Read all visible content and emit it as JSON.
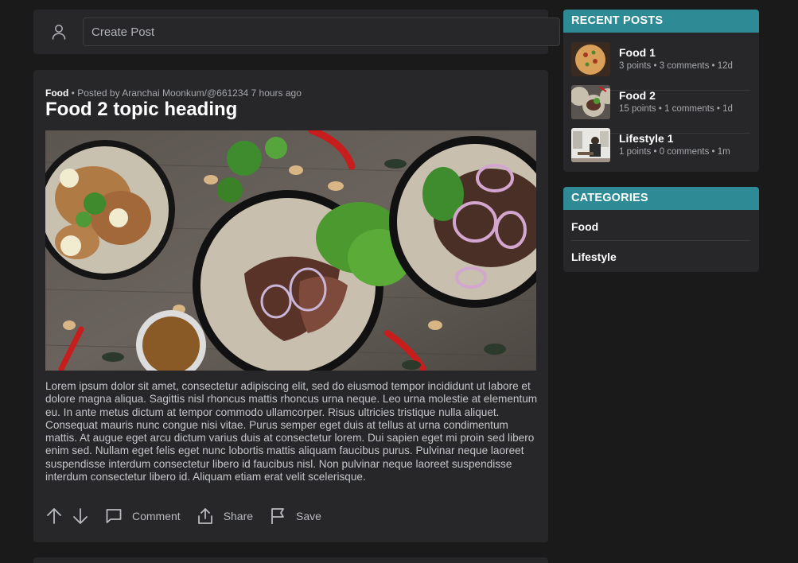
{
  "create_post": {
    "placeholder": "Create Post"
  },
  "post": {
    "category": "Food",
    "meta": "• Posted by Aranchai Moonkum/@661234 7 hours ago",
    "title": "Food 2 topic heading",
    "body": "Lorem ipsum dolor sit amet, consectetur adipiscing elit, sed do eiusmod tempor incididunt ut labore et dolore magna aliqua. Sagittis nisl rhoncus mattis rhoncus urna neque. Leo urna molestie at elementum eu. In ante metus dictum at tempor commodo ullamcorper. Risus ultricies tristique nulla aliquet. Consequat mauris nunc congue nisi vitae. Purus semper eget duis at tellus at urna condimentum mattis. At augue eget arcu dictum varius duis at consectetur lorem. Dui sapien eget mi proin sed libero enim sed. Nullam eget felis eget nunc lobortis mattis aliquam faucibus purus. Pulvinar neque laoreet suspendisse interdum consectetur libero id faucibus nisl. Non pulvinar neque laoreet suspendisse interdum consectetur libero id. Aliquam etiam erat velit scelerisque.",
    "actions": {
      "comment": "Comment",
      "share": "Share",
      "save": "Save"
    }
  },
  "sidebar": {
    "recent_title": "RECENT POSTS",
    "recent": [
      {
        "title": "Food 1",
        "stats": "3 points • 3 comments • 12d"
      },
      {
        "title": "Food 2",
        "stats": "15 points • 1 comments • 1d"
      },
      {
        "title": "Lifestyle 1",
        "stats": "1 points • 0 comments • 1m"
      }
    ],
    "categories_title": "CATEGORIES",
    "categories": [
      {
        "label": "Food"
      },
      {
        "label": "Lifestyle"
      }
    ]
  },
  "colors": {
    "accent": "#2e8a94",
    "background": "#1a1a1b",
    "card": "#272729"
  }
}
